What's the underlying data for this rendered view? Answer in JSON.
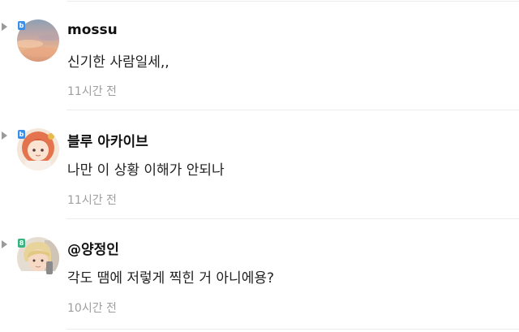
{
  "comments": [
    {
      "username": "mossu",
      "badge": "b",
      "badge_color": "#3d8ee6",
      "avatar_icon": "sunset-sky-avatar",
      "text": "신기한 사람일세,,",
      "time": "11시간 전"
    },
    {
      "username": "블루 아카이브",
      "badge": "b",
      "badge_color": "#3d8ee6",
      "avatar_icon": "anime-character-avatar",
      "text": "나만 이 상황 이해가 안되나",
      "time": "11시간 전"
    },
    {
      "username": "@양정인",
      "badge": "8",
      "badge_color": "#36b37e",
      "avatar_icon": "person-selfie-avatar",
      "text": "각도 땜에 저렇게 찍힌 거 아니에용?",
      "time": "10시간 전"
    }
  ]
}
